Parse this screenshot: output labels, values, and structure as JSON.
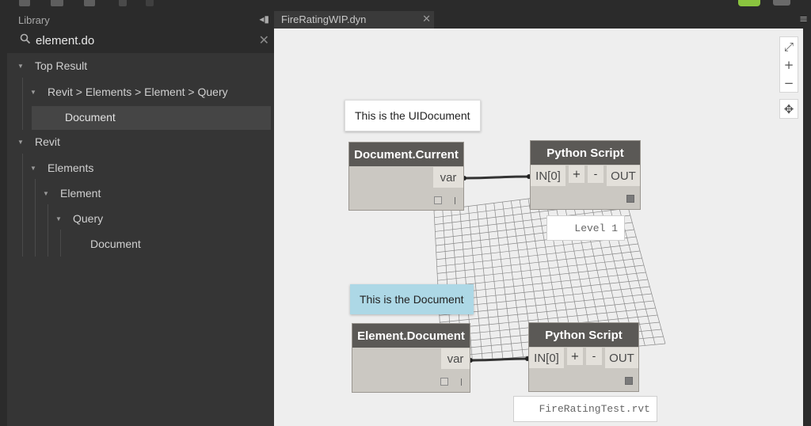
{
  "library": {
    "header": "Library",
    "collapse_icon": "◂▮",
    "search": {
      "value": "element.do",
      "clear_icon": "✕"
    },
    "tree": {
      "top_result": "Top Result",
      "revit_path": "Revit > Elements > Element > Query",
      "top_document": "Document",
      "revit": "Revit",
      "elements": "Elements",
      "element": "Element",
      "query": "Query",
      "document": "Document"
    }
  },
  "tabs": {
    "active": "FireRatingWIP.dyn",
    "close_icon": "✕",
    "menu_icon": "≡"
  },
  "zoom_controls": {
    "fit": "⤢",
    "zoom_in": "+",
    "zoom_out": "−",
    "pan": "✥"
  },
  "canvas": {
    "notes": {
      "uidocument": "This is the UIDocument",
      "document": "This is the Document"
    },
    "nodes": {
      "document_current": {
        "title": "Document.Current",
        "output": "var"
      },
      "python_script_1": {
        "title": "Python Script",
        "input": "IN[0]",
        "plus": "+",
        "minus": "-",
        "output": "OUT"
      },
      "element_document": {
        "title": "Element.Document",
        "output": "var"
      },
      "python_script_2": {
        "title": "Python Script",
        "input": "IN[0]",
        "plus": "+",
        "minus": "-",
        "output": "OUT"
      }
    },
    "watch": {
      "level": "Level 1",
      "file": "FireRatingTest.rvt"
    }
  },
  "colors": {
    "note_blue": "#add8e6",
    "note_white": "#ffffff",
    "node_header": "#5b5956",
    "node_body": "#cbc8c2",
    "run_green": "#8ac43f"
  }
}
